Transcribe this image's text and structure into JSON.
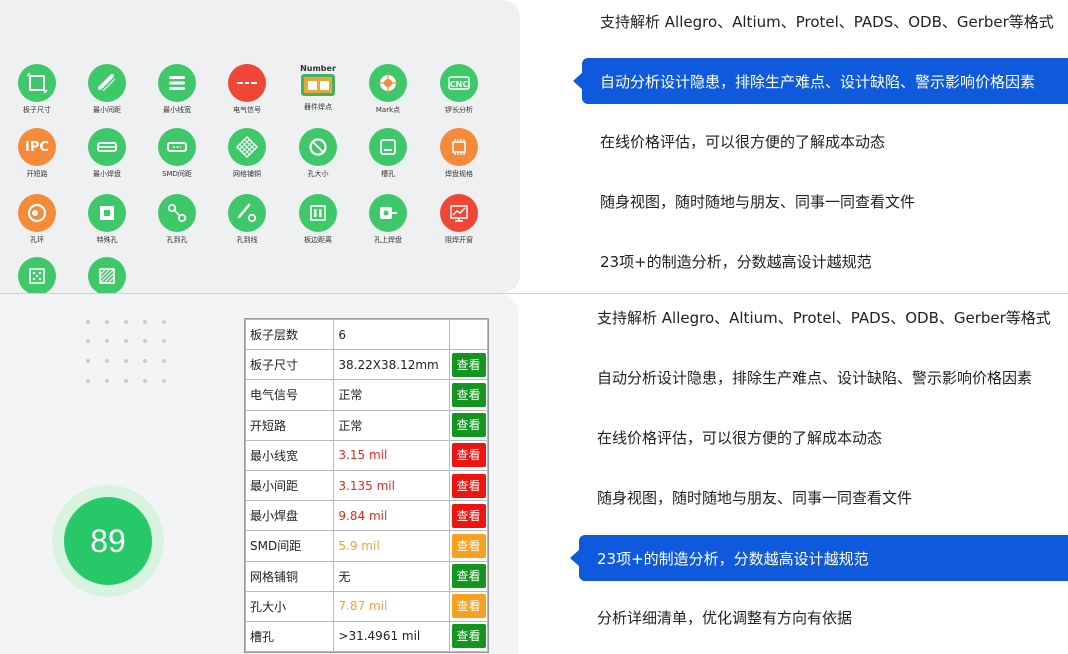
{
  "top_icons": [
    {
      "label": "板子尺寸",
      "icon": "board-size-icon",
      "color": "green"
    },
    {
      "label": "最小间距",
      "icon": "min-spacing-icon",
      "color": "green"
    },
    {
      "label": "最小线宽",
      "icon": "min-width-icon",
      "color": "green"
    },
    {
      "label": "电气信号",
      "icon": "electrical-signal-icon",
      "color": "red"
    },
    {
      "label": "器件焊点",
      "icon": "component-pad-icon",
      "color": "number",
      "top_text": "Number"
    },
    {
      "label": "Mark点",
      "icon": "mark-point-icon",
      "color": "green"
    },
    {
      "label": "锣长分析",
      "icon": "cnc-routing-icon",
      "color": "green",
      "inner_text": "CNC"
    },
    {
      "label": "开短路",
      "icon": "ipc-icon",
      "color": "orange",
      "inner_text": "IPC"
    },
    {
      "label": "最小焊盘",
      "icon": "min-pad-icon",
      "color": "green"
    },
    {
      "label": "SMD间距",
      "icon": "smd-spacing-icon",
      "color": "green"
    },
    {
      "label": "网格铺铜",
      "icon": "grid-copper-icon",
      "color": "green"
    },
    {
      "label": "孔大小",
      "icon": "hole-size-icon",
      "color": "green"
    },
    {
      "label": "槽孔",
      "icon": "slot-hole-icon",
      "color": "green"
    },
    {
      "label": "焊盘规格",
      "icon": "pad-spec-icon",
      "color": "orange"
    },
    {
      "label": "孔环",
      "icon": "annular-ring-icon",
      "color": "orange"
    },
    {
      "label": "特殊孔",
      "icon": "special-hole-icon",
      "color": "green"
    },
    {
      "label": "孔到孔",
      "icon": "hole-to-hole-icon",
      "color": "green"
    },
    {
      "label": "孔到线",
      "icon": "hole-to-line-icon",
      "color": "green"
    },
    {
      "label": "板边距离",
      "icon": "board-edge-icon",
      "color": "green"
    },
    {
      "label": "孔上焊盘",
      "icon": "pad-on-hole-icon",
      "color": "green"
    },
    {
      "label": "阻焊开窗",
      "icon": "solder-mask-icon",
      "color": "red"
    },
    {
      "label": "",
      "icon": "dice-pattern-icon",
      "color": "green"
    },
    {
      "label": "",
      "icon": "hatch-pattern-icon",
      "color": "green"
    }
  ],
  "features_top": [
    "支持解析 Allegro、Altium、Protel、PADS、ODB、Gerber等格式",
    "自动分析设计隐患，排除生产难点、设计缺陷、警示影响价格因素",
    "在线价格评估，可以很方便的了解成本动态",
    "随身视图，随时随地与朋友、同事一同查看文件",
    "23项+的制造分析，分数越高设计越规范"
  ],
  "features_bottom": [
    "支持解析 Allegro、Altium、Protel、PADS、ODB、Gerber等格式",
    "自动分析设计隐患，排除生产难点、设计缺陷、警示影响价格因素",
    "在线价格评估，可以很方便的了解成本动态",
    "随身视图，随时随地与朋友、同事一同查看文件",
    "23项+的制造分析，分数越高设计越规范",
    "分析详细清单，优化调整有方向有依据"
  ],
  "score": "89",
  "report_rows": [
    {
      "key": "板子层数",
      "value": "6",
      "status": "none",
      "button": ""
    },
    {
      "key": "板子尺寸",
      "value": "38.22X38.12mm",
      "status": "green",
      "button": "查看"
    },
    {
      "key": "电气信号",
      "value": "正常",
      "status": "green",
      "button": "查看"
    },
    {
      "key": "开短路",
      "value": "正常",
      "status": "green",
      "button": "查看"
    },
    {
      "key": "最小线宽",
      "value": "3.15 mil",
      "status": "red",
      "button": "查看"
    },
    {
      "key": "最小间距",
      "value": "3.135 mil",
      "status": "red",
      "button": "查看"
    },
    {
      "key": "最小焊盘",
      "value": "9.84 mil",
      "status": "red",
      "button": "查看"
    },
    {
      "key": "SMD间距",
      "value": "5.9 mil",
      "status": "orange",
      "button": "查看"
    },
    {
      "key": "网格铺铜",
      "value": "无",
      "status": "green",
      "button": "查看"
    },
    {
      "key": "孔大小",
      "value": "7.87 mil",
      "status": "orange",
      "button": "查看"
    },
    {
      "key": "槽孔",
      "value": ">31.4961 mil",
      "status": "green",
      "button": "查看"
    }
  ],
  "colors": {
    "accent_blue": "#0f5adc",
    "green": "#3fc86a",
    "orange": "#f58a3a",
    "red": "#ef4638",
    "score_green": "#27c868"
  }
}
